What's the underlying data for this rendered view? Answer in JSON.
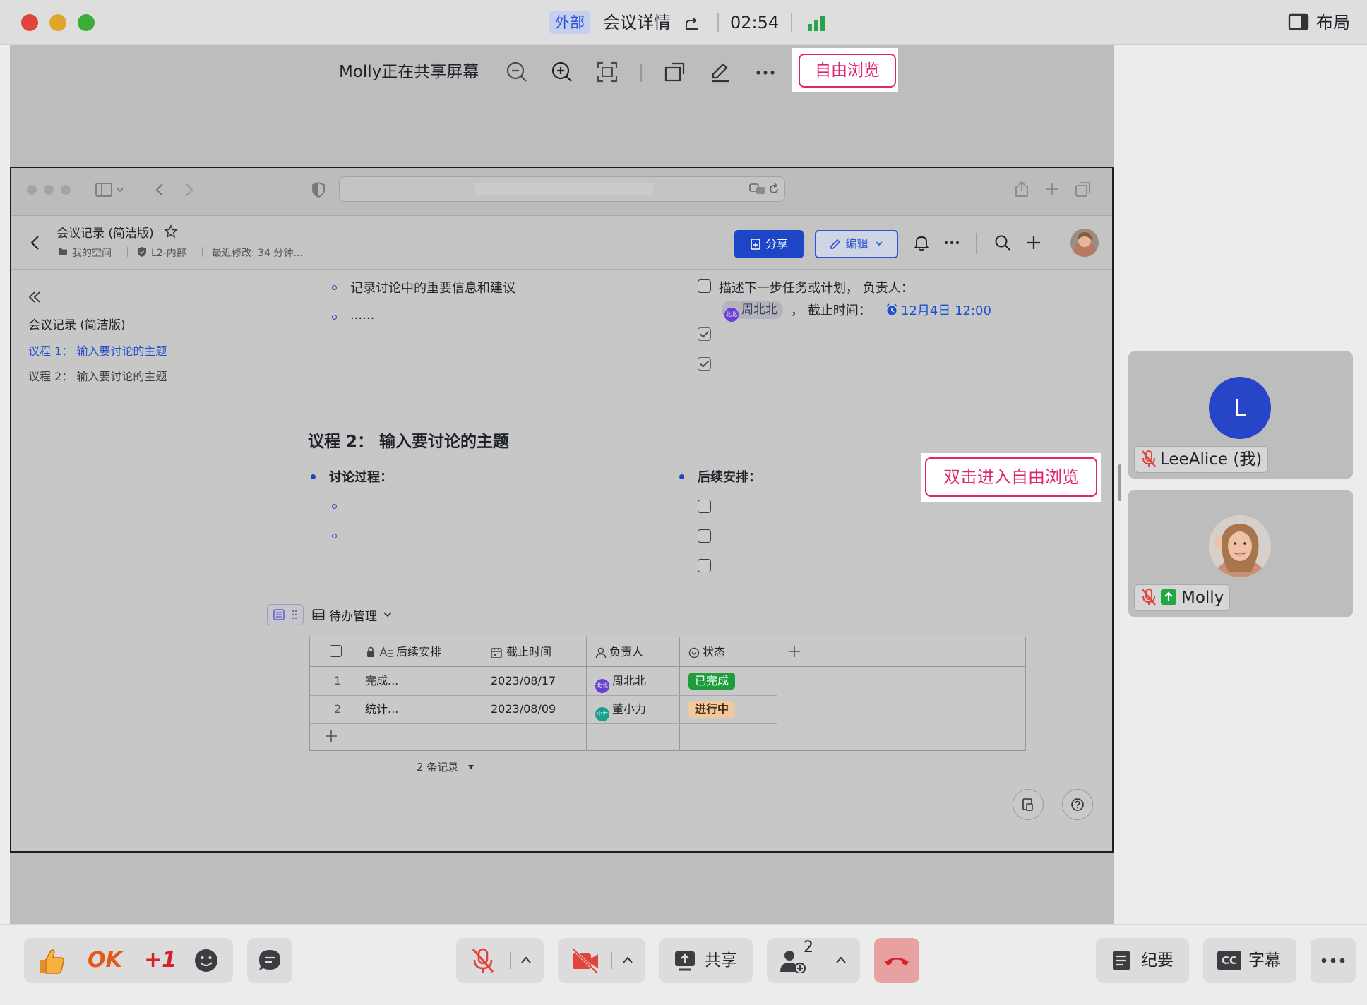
{
  "titlebar": {
    "tag_external": "外部",
    "meeting_detail": "会议详情",
    "timer": "02:54",
    "layout_label": "布局"
  },
  "share_toolbar": {
    "sharing_text": "Molly正在共享屏幕",
    "free_browse_label": "自由浏览",
    "icons": [
      "zoom-out-icon",
      "zoom-in-icon",
      "fit-screen-icon",
      "new-window-icon",
      "annotate-icon",
      "more-icon"
    ]
  },
  "hint": {
    "double_click_text": "双击进入自由浏览"
  },
  "doc": {
    "title": "会议记录 (简洁版)",
    "meta_space": "我的空间",
    "meta_level": "L2-内部",
    "meta_modified": "最近修改: 34 分钟...",
    "share_btn": "分享",
    "edit_btn": "编辑",
    "outline": {
      "title": "会议记录 (简洁版)",
      "item1": "议程 1： 输入要讨论的主题",
      "item2": "议程 2： 输入要讨论的主题"
    },
    "top_left_bullet1": "记录讨论中的重要信息和建议",
    "top_left_bullet2": "......",
    "task_desc": "描述下一步任务或计划， 负责人：",
    "task_person": "周北北",
    "task_person_avatar": "北北",
    "task_deadline_label": "， 截止时间：",
    "task_deadline": "12月4日 12:00",
    "agenda2_title": "议程 2： 输入要讨论的主题",
    "discussion_label": "讨论过程：",
    "followup_label": "后续安排："
  },
  "table": {
    "view_name": "待办管理",
    "headers": [
      "后续安排",
      "截止时间",
      "负责人",
      "状态"
    ],
    "rows": [
      {
        "idx": "1",
        "task": "完成...",
        "date": "2023/08/17",
        "owner": "周北北",
        "owner_avatar": "北北",
        "status": "已完成"
      },
      {
        "idx": "2",
        "task": "统计...",
        "date": "2023/08/09",
        "owner": "董小力",
        "owner_avatar": "小力",
        "status": "进行中"
      }
    ],
    "record_count": "2 条记录"
  },
  "participants": [
    {
      "name": "LeeAlice (我)",
      "initial": "L"
    },
    {
      "name": "Molly"
    }
  ],
  "bottom": {
    "reactions": [
      "OK",
      "+1"
    ],
    "share_label": "共享",
    "participant_count": "2",
    "minutes_label": "纪要",
    "subtitle_label": "字幕",
    "cc_label": "CC"
  },
  "colors": {
    "accent_blue": "#1d46c7",
    "free_browse_pink": "#e0256f",
    "hangup_red": "#e8a1a1",
    "done_green": "#1f9d3c",
    "progress_orange": "#f1c9a0"
  }
}
